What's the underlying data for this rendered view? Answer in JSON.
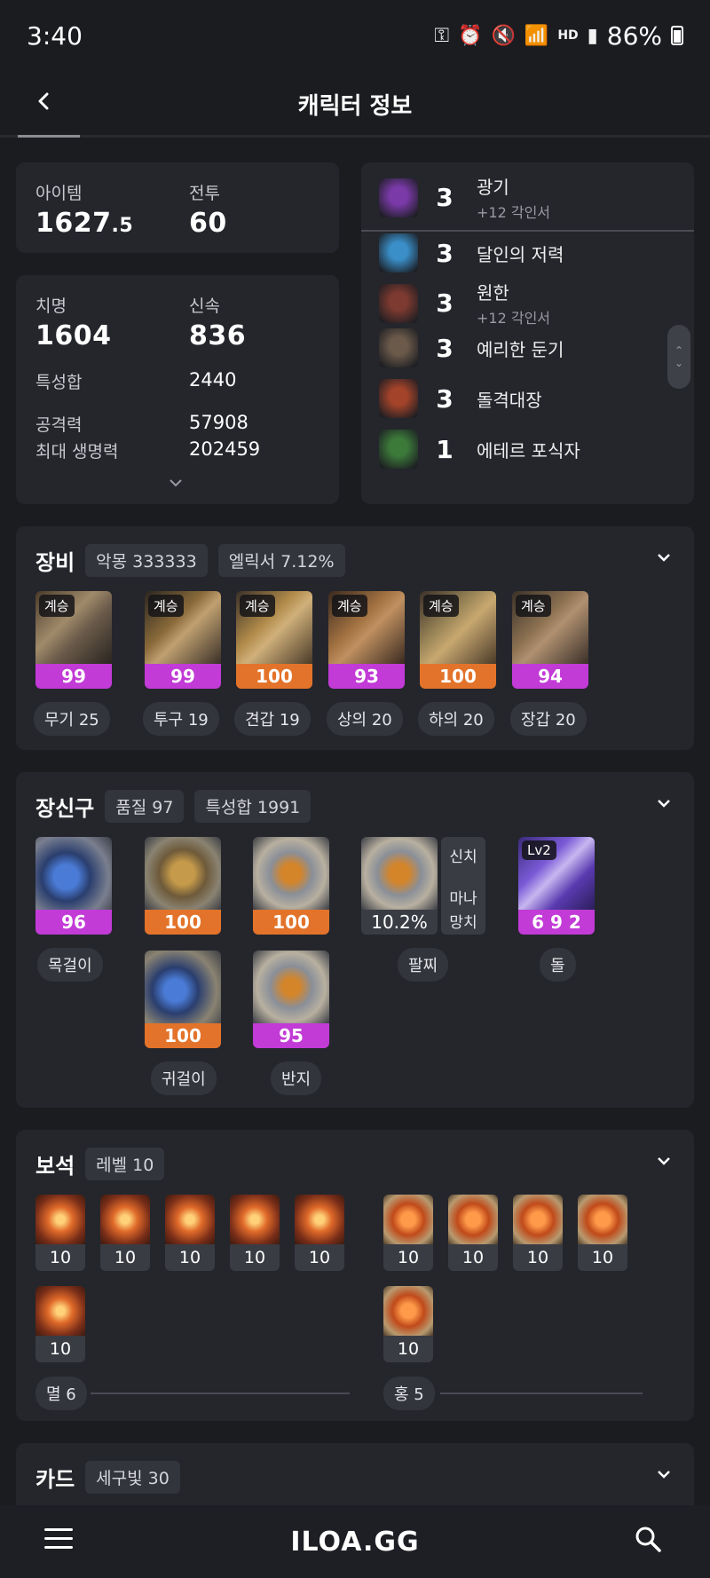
{
  "status": {
    "time": "3:40",
    "battery": "86%",
    "hd": "HD"
  },
  "header": {
    "title": "캐릭터 정보",
    "back_icon": "chevron-left-icon"
  },
  "stats_top": {
    "item_label": "아이템",
    "item_value_main": "1627",
    "item_value_frac": ".5",
    "combat_label": "전투",
    "combat_value": "60"
  },
  "stats": {
    "crit_label": "치명",
    "crit_value": "1604",
    "swift_label": "신속",
    "swift_value": "836",
    "sum_label": "특성합",
    "sum_value": "2440",
    "atk_label": "공격력",
    "atk_value": "57908",
    "hp_label": "최대 생명력",
    "hp_value": "202459"
  },
  "engravings": [
    {
      "level": "3",
      "name": "광기",
      "sub": "+12 각인서",
      "color": "#7a3aa8"
    },
    {
      "level": "3",
      "name": "달인의 저력",
      "sub": "",
      "color": "#3a8fc9"
    },
    {
      "level": "3",
      "name": "원한",
      "sub": "+12 각인서",
      "color": "#7d3a30"
    },
    {
      "level": "3",
      "name": "예리한 둔기",
      "sub": "",
      "color": "#6b5a4a"
    },
    {
      "level": "3",
      "name": "돌격대장",
      "sub": "",
      "color": "#a3432a"
    },
    {
      "level": "1",
      "name": "에테르 포식자",
      "sub": "",
      "color": "#3c7a3a"
    }
  ],
  "equipment": {
    "title": "장비",
    "chips": [
      "악몽 333333",
      "엘릭서 7.12%"
    ],
    "items": [
      {
        "tag": "계승",
        "quality": "99",
        "bar": "purple",
        "label": "무기 25"
      },
      {
        "tag": "계승",
        "quality": "99",
        "bar": "purple",
        "label": "투구 19"
      },
      {
        "tag": "계승",
        "quality": "100",
        "bar": "orange",
        "label": "견갑 19"
      },
      {
        "tag": "계승",
        "quality": "93",
        "bar": "purple",
        "label": "상의 20"
      },
      {
        "tag": "계승",
        "quality": "100",
        "bar": "orange",
        "label": "하의 20"
      },
      {
        "tag": "계승",
        "quality": "94",
        "bar": "purple",
        "label": "장갑 20"
      }
    ]
  },
  "accessories": {
    "title": "장신구",
    "chips": [
      "품질 97",
      "특성합 1991"
    ],
    "necklace": {
      "quality": "96",
      "bar": "purple",
      "label": "목걸이"
    },
    "earring1": {
      "quality": "100",
      "bar": "orange"
    },
    "ring1": {
      "quality": "100",
      "bar": "orange"
    },
    "earring2": {
      "quality": "100",
      "bar": "orange"
    },
    "ring2": {
      "quality": "95",
      "bar": "purple"
    },
    "earring_label": "귀걸이",
    "ring_label": "반지",
    "bracelet": {
      "value": "10.2%",
      "label": "팔찌",
      "effect1": "신치",
      "effect2": "마나",
      "effect3": "망치"
    },
    "stone": {
      "tag": "Lv2",
      "value": "6 9 2",
      "label": "돌"
    }
  },
  "gems": {
    "title": "보석",
    "chip": "레벨 10",
    "left_values": [
      "10",
      "10",
      "10",
      "10",
      "10",
      "10"
    ],
    "right_values": [
      "10",
      "10",
      "10",
      "10",
      "10"
    ],
    "left_label": "멸 6",
    "right_label": "홍 5"
  },
  "cards": {
    "title": "카드",
    "chip": "세구빛 30"
  },
  "bottom": {
    "brand": "ILOA.GG"
  }
}
